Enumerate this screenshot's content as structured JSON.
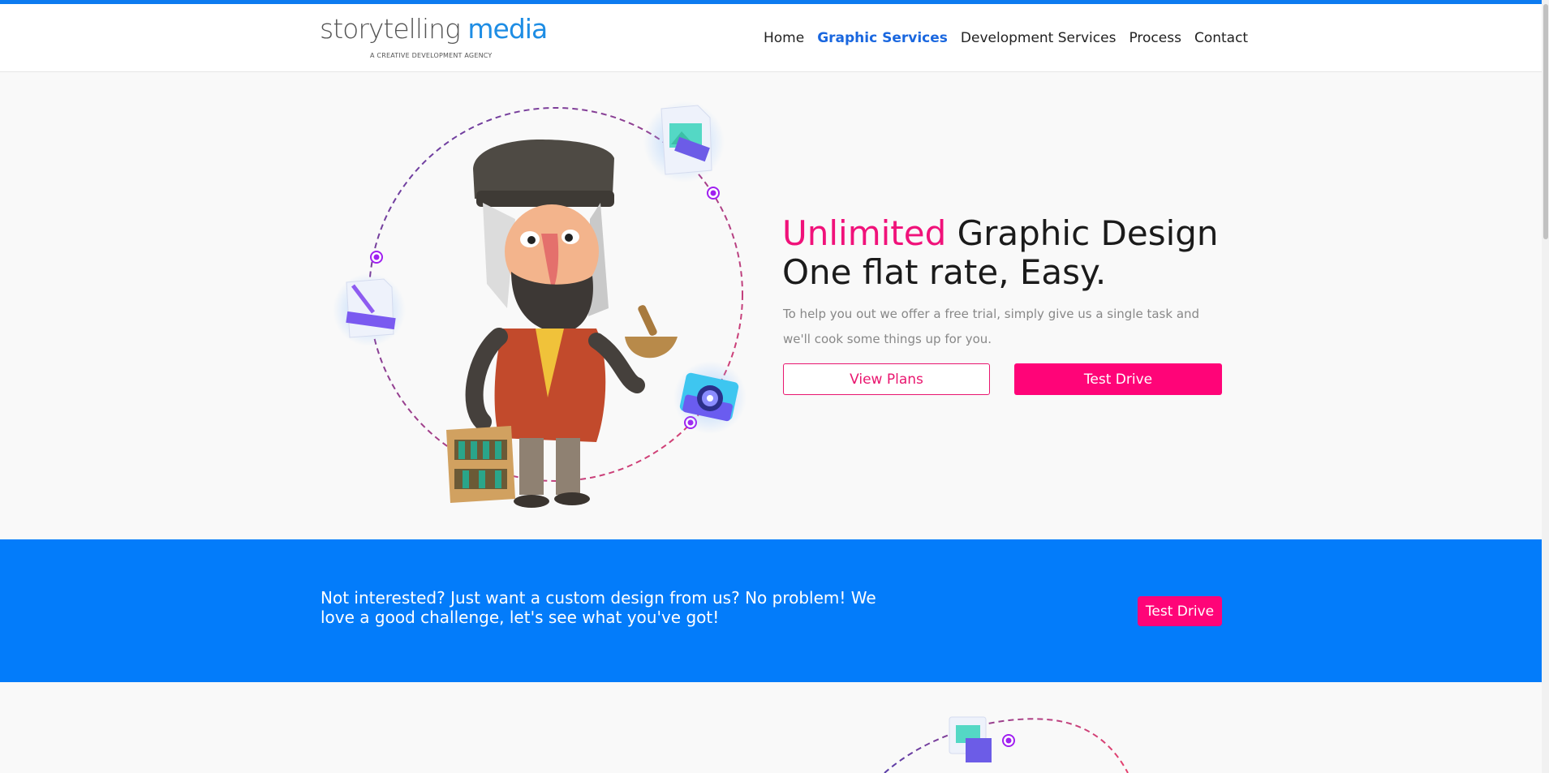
{
  "header": {
    "logo_word1": "storytelling",
    "logo_word2": "media",
    "logo_tagline": "A CREATIVE DEVELOPMENT AGENCY",
    "nav": [
      {
        "label": "Home",
        "active": false
      },
      {
        "label": "Graphic Services",
        "active": true
      },
      {
        "label": "Development Services",
        "active": false
      },
      {
        "label": "Process",
        "active": false
      },
      {
        "label": "Contact",
        "active": false
      }
    ]
  },
  "hero": {
    "title_highlight": "Unlimited",
    "title_rest": " Graphic Design",
    "title_line2": "One flat rate, Easy.",
    "description": "To help you out we offer a free trial, simply give us a single task and we'll cook some things up for you.",
    "view_plans_label": "View Plans",
    "test_drive_label": "Test Drive"
  },
  "band": {
    "text": "Not interested? Just want a custom design from us? No problem! We love a good challenge, let's see what you've got!",
    "button_label": "Test Drive"
  },
  "colors": {
    "accent_blue": "#037cfa",
    "accent_pink": "#ff0478",
    "nav_active": "#1a67df"
  }
}
